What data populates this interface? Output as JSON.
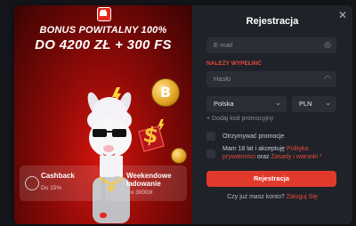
{
  "promo": {
    "title_line1": "BONUS POWITALNY 100%",
    "title_line2": "DO 4200 ZŁ + 300 FS",
    "coin_symbol": "B",
    "features": [
      {
        "name": "Cashback",
        "sub": "Do 15%"
      },
      {
        "name": "Weekendowe ładowanie",
        "sub": "Do 3000zł"
      }
    ]
  },
  "form": {
    "title": "Rejestracja",
    "email_placeholder": "E-mail",
    "error_text": "NALEŻY WYPEŁNIĆ",
    "password_placeholder": "Hasło",
    "country_value": "Polska",
    "currency_value": "PLN",
    "promo_code_label": "+ Dodaj kod promocyjny",
    "checkbox_promos": "Otrzymywać promocje",
    "terms_part1": "Mam 18 lat i akceptuję ",
    "terms_link1": "Polityka prywatności",
    "terms_part2": " oraz ",
    "terms_link2": "Zasady i warunki",
    "terms_star": " *",
    "register_button": "Rejestracja",
    "login_prompt": "Czy już masz konto?",
    "login_link": "Zaloguj Się"
  },
  "colors": {
    "accent": "#e03a2c",
    "promo_red": "#d6140e",
    "panel": "#1f2229"
  },
  "icons": {
    "close": "close-icon",
    "email": "at-icon",
    "password": "eye-icon",
    "chevron": "chevron-down-icon"
  }
}
